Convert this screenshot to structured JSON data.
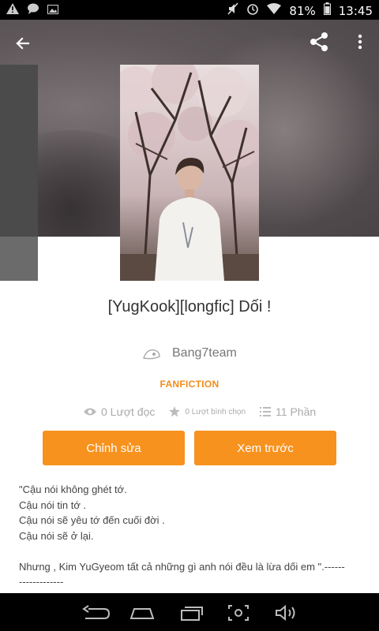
{
  "status_bar": {
    "battery": "81%",
    "time": "13:45"
  },
  "story": {
    "title": "[YugKook][longfic] Dối !",
    "author": "Bang7team",
    "category": "FANFICTION"
  },
  "stats": {
    "reads": "0 Lượt đọc",
    "votes": "0 Lượt bình chọn",
    "parts": "11 Phần"
  },
  "actions": {
    "edit_label": "Chỉnh sửa",
    "preview_label": "Xem trước"
  },
  "description": {
    "lines": [
      "\"Cậu nói không ghét tớ.",
      "Cậu nói tin tớ .",
      "Cậu nói sẽ yêu tớ đến cuối đời .",
      "Cậu nói sẽ ở lại.",
      "Nhưng , Kim YuGyeom tất cả những gì anh nói đều là lừa dối em \".------",
      "-------------"
    ]
  },
  "colors": {
    "accent": "#f7921e",
    "category": "#f28c19"
  },
  "icons": {
    "back": "arrow-left-icon",
    "share": "share-icon",
    "more": "more-vertical-icon",
    "reads": "eye-icon",
    "votes": "star-icon",
    "parts": "list-icon",
    "nav_back": "nav-back-icon",
    "nav_home": "nav-home-icon",
    "nav_recent": "nav-recent-icon",
    "nav_screenshot": "nav-screenshot-icon",
    "nav_volume": "nav-volume-icon"
  }
}
